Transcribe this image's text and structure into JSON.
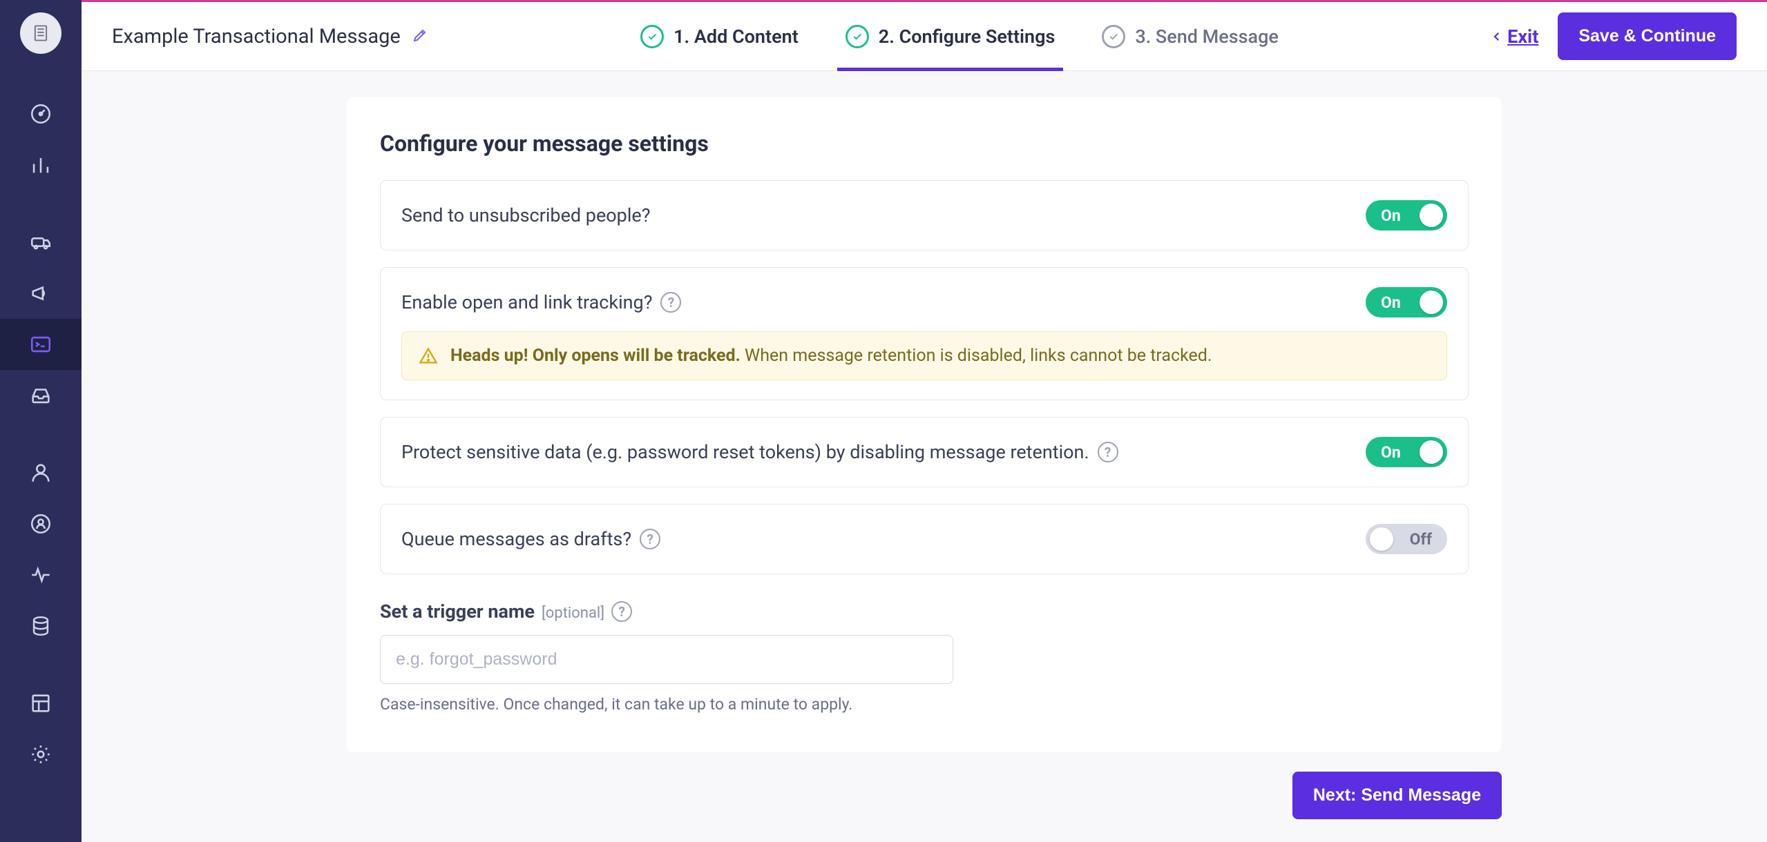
{
  "header": {
    "title": "Example Transactional Message",
    "exit_label": "Exit",
    "save_label": "Save & Continue"
  },
  "steps": {
    "s1": "1. Add Content",
    "s2": "2. Configure Settings",
    "s3": "3. Send Message"
  },
  "panel": {
    "title": "Configure your message settings",
    "unsub_label": "Send to unsubscribed people?",
    "tracking_label": "Enable open and link tracking?",
    "alert_bold": "Heads up! Only opens will be tracked.",
    "alert_rest": " When message retention is disabled, links cannot be tracked.",
    "protect_label": "Protect sensitive data (e.g. password reset tokens) by disabling message retention.",
    "drafts_label": "Queue messages as drafts?",
    "on": "On",
    "off": "Off"
  },
  "trigger": {
    "title": "Set a trigger name",
    "optional": "[optional]",
    "placeholder": "e.g. forgot_password",
    "helper": "Case-insensitive. Once changed, it can take up to a minute to apply."
  },
  "footer": {
    "next_label": "Next: Send Message"
  }
}
